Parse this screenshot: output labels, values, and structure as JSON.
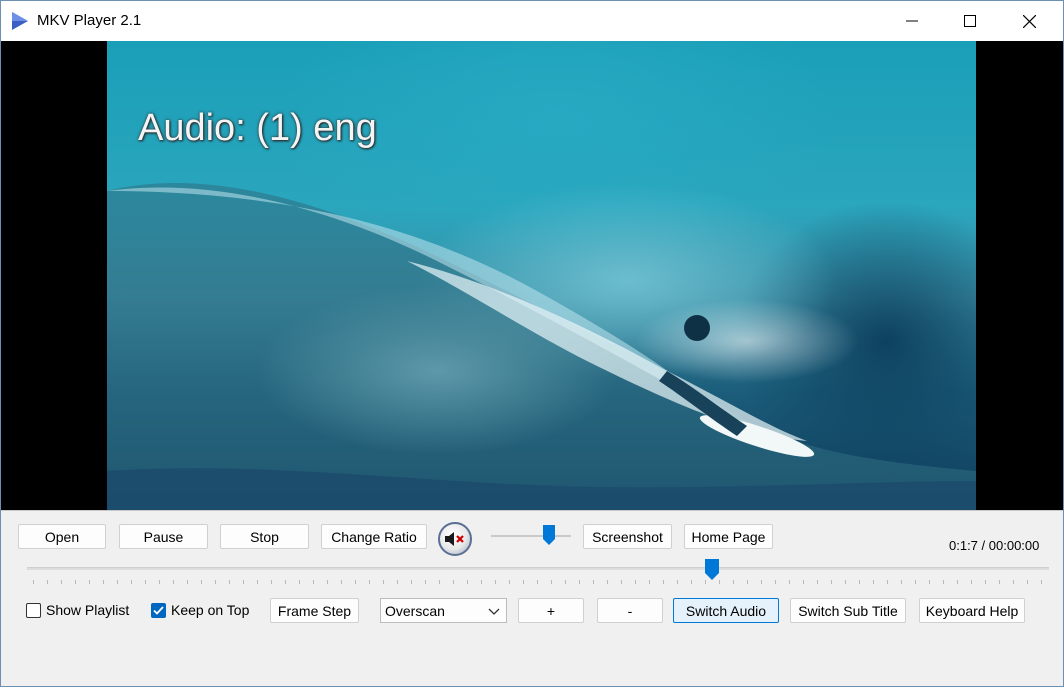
{
  "window": {
    "title": "MKV Player 2.1",
    "icons": {
      "app": "play-triangle-icon",
      "minimize": "minimize-icon",
      "maximize": "maximize-icon",
      "close": "close-icon"
    }
  },
  "video": {
    "osd_text": "Audio: (1) eng"
  },
  "controls": {
    "open": "Open",
    "pause": "Pause",
    "stop": "Stop",
    "change_ratio": "Change Ratio",
    "mute_icon": "speaker-muted-icon",
    "volume_level": 0.72,
    "screenshot": "Screenshot",
    "home_page": "Home Page",
    "time_current": "0:1:7",
    "time_separator": " / ",
    "time_total": "00:00:00",
    "seek_position": 0.67,
    "show_playlist": {
      "label": "Show Playlist",
      "checked": false
    },
    "keep_on_top": {
      "label": "Keep on Top",
      "checked": true
    },
    "frame_step": "Frame Step",
    "scan_mode": "Overscan",
    "plus": "+",
    "minus": "-",
    "switch_audio": "Switch Audio",
    "switch_subtitle": "Switch Sub Title",
    "keyboard_help": "Keyboard Help"
  },
  "colors": {
    "accent": "#0078d7",
    "checkbox": "#0067c0",
    "slider_thumb": "#0078d7",
    "panel": "#f0f0f0"
  }
}
